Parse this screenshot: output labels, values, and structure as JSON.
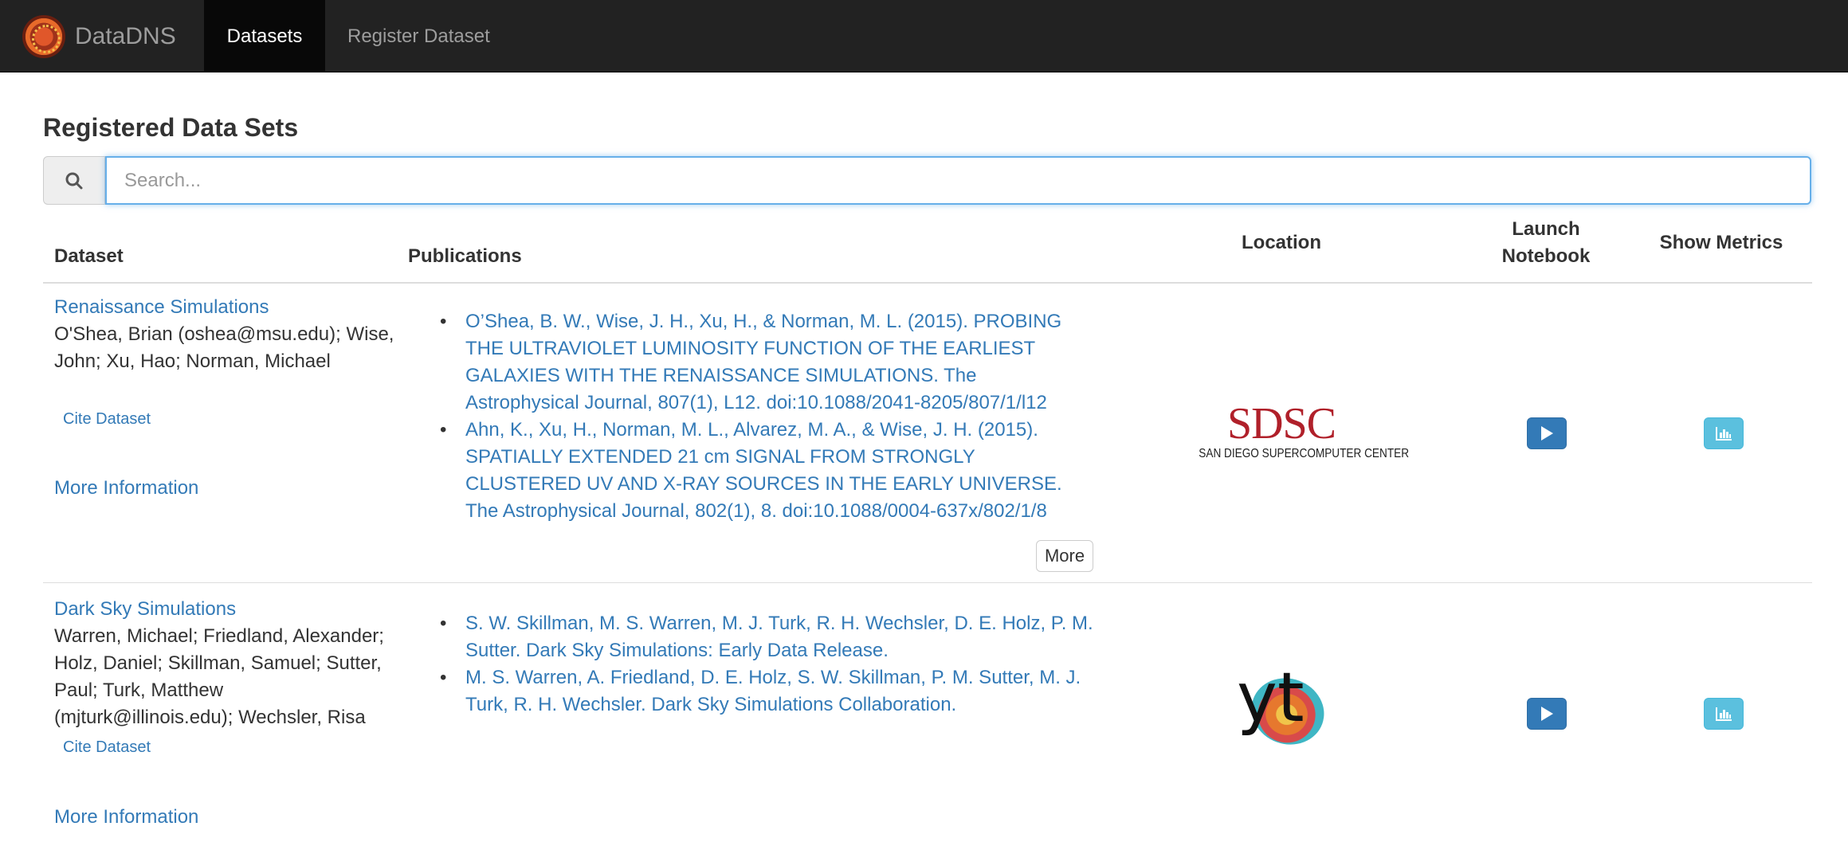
{
  "navbar": {
    "brand": "DataDNS",
    "items": [
      {
        "label": "Datasets",
        "active": true
      },
      {
        "label": "Register Dataset",
        "active": false
      }
    ]
  },
  "page": {
    "title": "Registered Data Sets"
  },
  "search": {
    "placeholder": "Search...",
    "value": "",
    "icon": "search-icon"
  },
  "table": {
    "headers": {
      "dataset": "Dataset",
      "publications": "Publications",
      "location": "Location",
      "launch": "Launch Notebook",
      "metrics": "Show Metrics"
    },
    "rows": [
      {
        "name": "Renaissance Simulations",
        "authors": "O'Shea, Brian (oshea@msu.edu); Wise, John; Xu, Hao; Norman, Michael",
        "cite": "Cite Dataset",
        "more_info": "More Information",
        "publications": [
          "O’Shea, B. W., Wise, J. H., Xu, H., & Norman, M. L. (2015). PROBING THE ULTRAVIOLET LUMINOSITY FUNCTION OF THE EARLIEST GALAXIES WITH THE RENAISSANCE SIMULATIONS. The Astrophysical Journal, 807(1), L12. doi:10.1088/2041-8205/807/1/l12",
          "Ahn, K., Xu, H., Norman, M. L., Alvarez, M. A., & Wise, J. H. (2015). SPATIALLY EXTENDED 21 cm SIGNAL FROM STRONGLY CLUSTERED UV AND X-RAY SOURCES IN THE EARLY UNIVERSE. The Astrophysical Journal, 802(1), 8. doi:10.1088/0004-637x/802/1/8"
        ],
        "more_button": "More",
        "location_logo": {
          "big": "SDSC",
          "small": "SAN DIEGO SUPERCOMPUTER CENTER"
        }
      },
      {
        "name": "Dark Sky Simulations",
        "authors": "Warren, Michael; Friedland, Alexander; Holz, Daniel; Skillman, Samuel; Sutter, Paul; Turk, Matthew (mjturk@illinois.edu); Wechsler, Risa",
        "cite": "Cite Dataset",
        "more_info": "More Information",
        "publications": [
          "S. W. Skillman, M. S. Warren, M. J. Turk, R. H. Wechsler, D. E. Holz, P. M. Sutter. Dark Sky Simulations: Early Data Release.",
          "M. S. Warren, A. Friedland, D. E. Holz, S. W. Skillman, P. M. Sutter, M. J. Turk, R. H. Wechsler. Dark Sky Simulations Collaboration."
        ],
        "location_logo": {
          "text": "yt"
        }
      }
    ]
  },
  "colors": {
    "navbar_bg": "#222222",
    "link": "#337ab7",
    "play_button": "#337ab7",
    "metrics_button": "#5bc0de",
    "sdsc_red": "#b0202a"
  }
}
